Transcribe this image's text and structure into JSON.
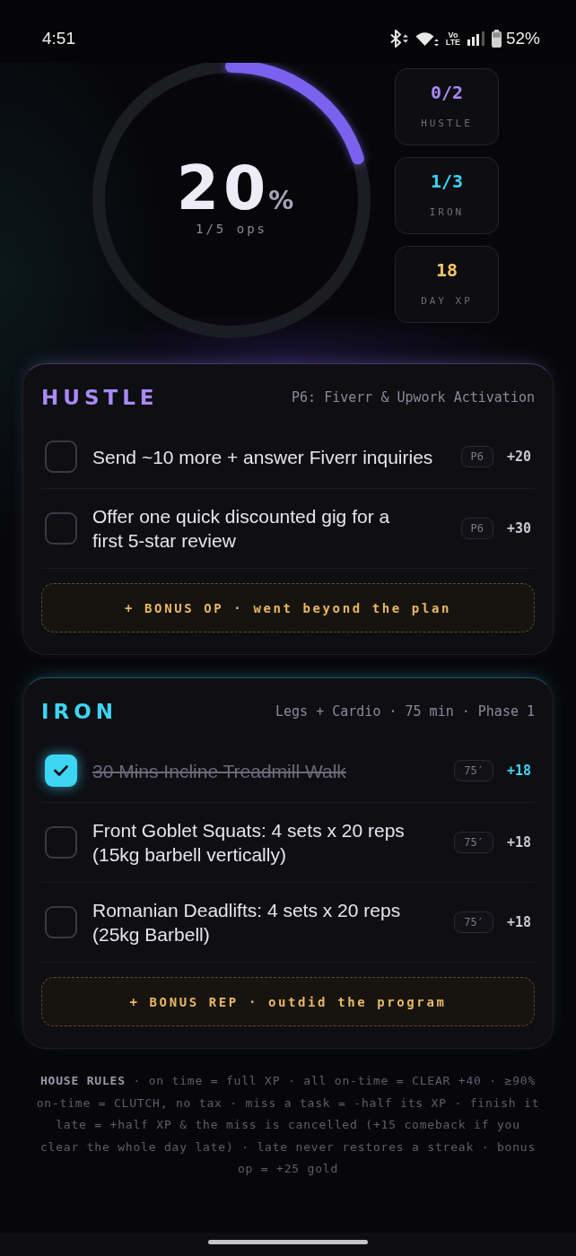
{
  "status_bar": {
    "time": "4:51",
    "network": "Vo LTE",
    "battery": "52%"
  },
  "progress": {
    "level": 0.2,
    "value": "20",
    "unit": "%",
    "caption": "1/5 ops"
  },
  "stats": [
    {
      "value": "0/2",
      "label": "HUSTLE",
      "color": "#a98af7"
    },
    {
      "value": "1/3",
      "label": "IRON",
      "color": "#3dd5f3"
    },
    {
      "value": "18",
      "label": "DAY XP",
      "color": "#f4c66a"
    }
  ],
  "sections": [
    {
      "title": "HUSTLE",
      "subtitle": "P6: Fiverr & Upwork Activation",
      "color": "#a98af7",
      "tasks": [
        {
          "text": "Send ~10 more + answer Fiverr inquiries",
          "checked": false,
          "tag": "P6",
          "points": "+20"
        },
        {
          "text": "Offer one quick discounted gig for a\nfirst 5-star review",
          "checked": false,
          "tag": "P6",
          "points": "+30"
        }
      ],
      "bonus": "+ BONUS OP · went beyond the plan"
    },
    {
      "title": "IRON",
      "subtitle": "Legs + Cardio · 75 min · Phase 1",
      "color": "#3dd5f3",
      "tasks": [
        {
          "text": "30 Mins Incline Treadmill Walk",
          "checked": true,
          "tag": "75′",
          "points": "+18"
        },
        {
          "text": "Front Goblet Squats: 4 sets x 20 reps\n(15kg barbell vertically)",
          "checked": false,
          "tag": "75′",
          "points": "+18"
        },
        {
          "text": "Romanian Deadlifts: 4 sets x 20 reps\n(25kg Barbell)",
          "checked": false,
          "tag": "75′",
          "points": "+18"
        }
      ],
      "bonus": "+ BONUS REP · outdid the program"
    }
  ],
  "house_rules": "**HOUSE RULES** · on time = full XP · all on-time = CLEAR +40 · ≥90% on-time = CLUTCH, no tax · miss a task = -half its XP · finish it late = +half XP & the miss is cancelled (+15 comeback if you clear the whole day late) · late never restores a streak · bonus op = +25 gold"
}
